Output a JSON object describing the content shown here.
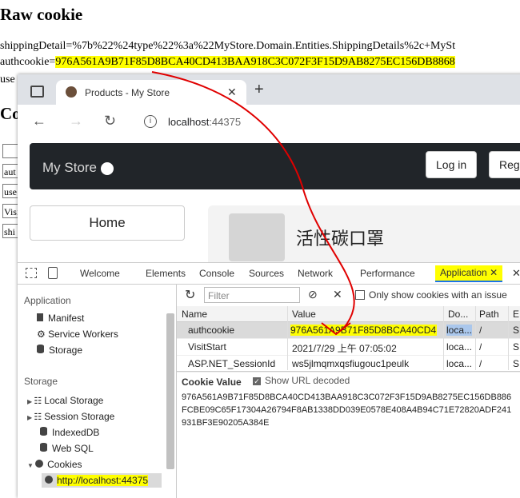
{
  "bg": {
    "title": "Raw cookie",
    "line1": "shippingDetail=%7b%22%24type%22%3a%22MyStore.Domain.Entities.ShippingDetails%2c+MySt",
    "line2_prefix": "authcookie=",
    "line2_value": "976A561A9B71F85D8BCA40CD413BAA918C3C072F3F15D9AB8275EC156DB8868",
    "line3": "use",
    "h2": "Co",
    "cells": [
      "",
      "aut",
      "use",
      "Visi",
      "shi"
    ]
  },
  "browser": {
    "tab_title": "Products - My Store",
    "url_host": "localhost",
    "url_port": ":44375"
  },
  "site": {
    "brand": "My Store",
    "login": "Log in",
    "register": "Reg",
    "home": "Home",
    "product_name": "活性碳口罩"
  },
  "devtools": {
    "tabs": [
      "Welcome",
      "Elements",
      "Console",
      "Sources",
      "Network",
      "Performance",
      "Application"
    ],
    "sidebar": {
      "application_header": "Application",
      "app_items": [
        "Manifest",
        "Service Workers",
        "Storage"
      ],
      "storage_header": "Storage",
      "storage_items": [
        "Local Storage",
        "Session Storage",
        "IndexedDB",
        "Web SQL",
        "Cookies"
      ],
      "cookie_origin": "http://localhost:44375"
    },
    "filter_placeholder": "Filter",
    "only_issue_label": "Only show cookies with an issue",
    "columns": [
      "Name",
      "Value",
      "Do...",
      "Path",
      "E"
    ],
    "rows": [
      {
        "name": "authcookie",
        "value": "976A561A9B71F85D8BCA40CD4...",
        "domain": "loca...",
        "path": "/",
        "e": "S"
      },
      {
        "name": "VisitStart",
        "value": "2021/7/29 上午 07:05:02",
        "domain": "loca...",
        "path": "/",
        "e": "S"
      },
      {
        "name": "ASP.NET_SessionId",
        "value": "ws5jlmqmxqsfiugouc1peulk",
        "domain": "loca...",
        "path": "/",
        "e": "S"
      }
    ],
    "cookie_value_title": "Cookie Value",
    "show_url_decoded": "Show URL decoded",
    "cookie_value_lines": [
      "976A561A9B71F85D8BCA40CD413BAA918C3C072F3F15D9AB8275EC156DB886",
      "FCBE09C65F17304A26794F8AB1338DD039E0578E408A4B94C71E72820ADF241",
      "931BF3E90205A384E"
    ]
  },
  "colors": {
    "highlight": "#ffff00",
    "arrow": "#e00000",
    "site_header": "#212529"
  }
}
